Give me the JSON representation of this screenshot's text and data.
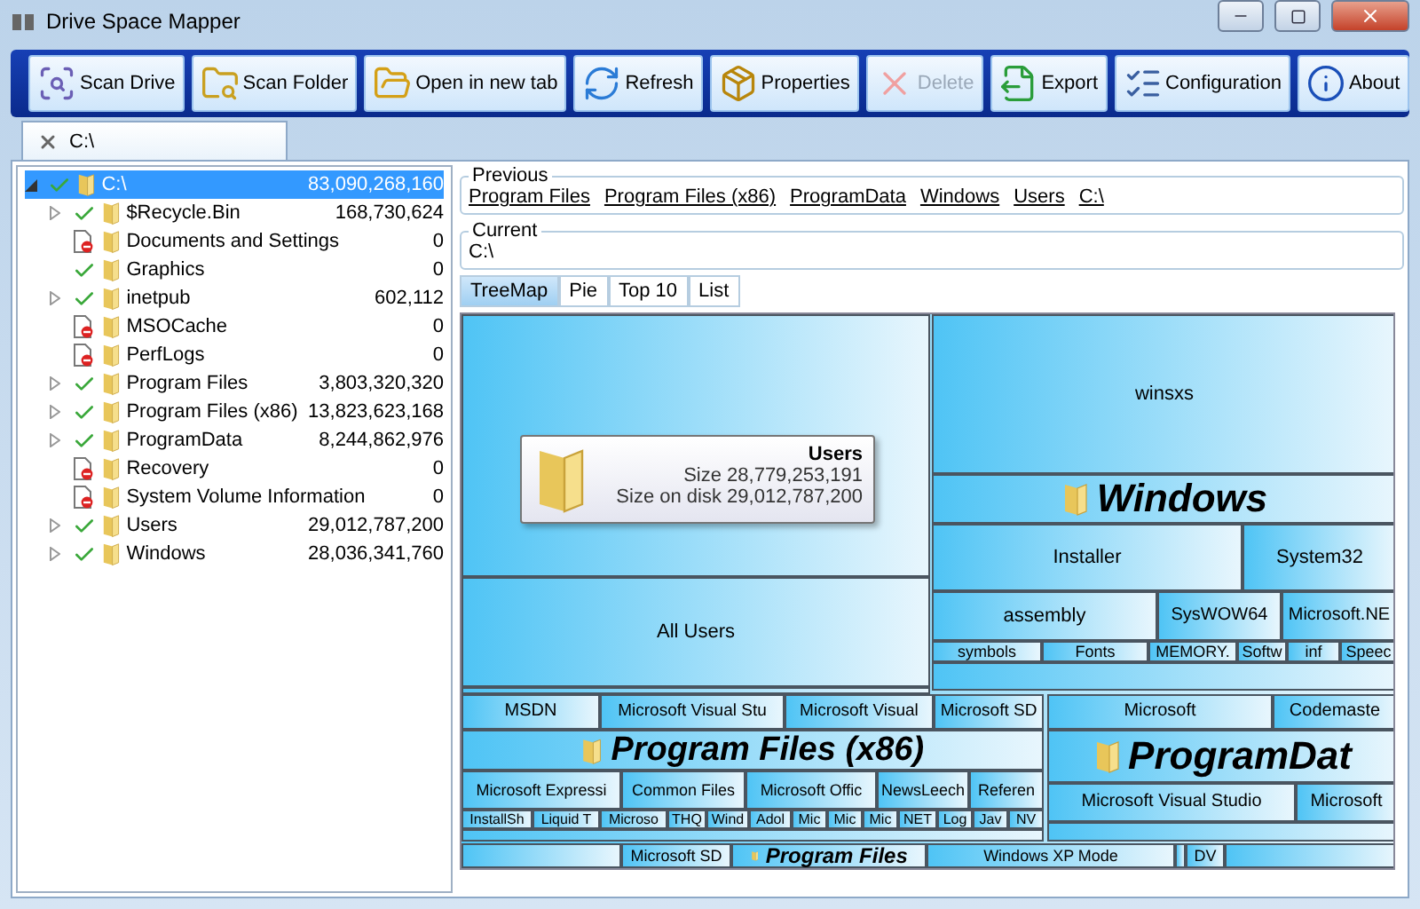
{
  "window": {
    "title": "Drive Space Mapper"
  },
  "toolbar": [
    {
      "label": "Scan Drive",
      "disabled": false
    },
    {
      "label": "Scan Folder",
      "disabled": false
    },
    {
      "label": "Open in new tab",
      "disabled": false
    },
    {
      "label": "Refresh",
      "disabled": false
    },
    {
      "label": "Properties",
      "disabled": false
    },
    {
      "label": "Delete",
      "disabled": true
    },
    {
      "label": "Export",
      "disabled": false
    },
    {
      "label": "Configuration",
      "disabled": false
    },
    {
      "label": "About",
      "disabled": false
    }
  ],
  "tabs": [
    {
      "label": "C:\\",
      "selected": true
    }
  ],
  "tree": {
    "name": "C:\\",
    "size": "83,090,268,160",
    "expanded": true,
    "selected": true,
    "accessible": true,
    "children": [
      {
        "name": "$Recycle.Bin",
        "size": "168,730,624",
        "accessible": true,
        "expandable": true
      },
      {
        "name": "Documents and Settings",
        "size": "0",
        "accessible": false,
        "expandable": false
      },
      {
        "name": "Graphics",
        "size": "0",
        "accessible": true,
        "expandable": false
      },
      {
        "name": "inetpub",
        "size": "602,112",
        "accessible": true,
        "expandable": true
      },
      {
        "name": "MSOCache",
        "size": "0",
        "accessible": false,
        "expandable": false
      },
      {
        "name": "PerfLogs",
        "size": "0",
        "accessible": false,
        "expandable": false
      },
      {
        "name": "Program Files",
        "size": "3,803,320,320",
        "accessible": true,
        "expandable": true
      },
      {
        "name": "Program Files (x86)",
        "size": "13,823,623,168",
        "accessible": true,
        "expandable": true
      },
      {
        "name": "ProgramData",
        "size": "8,244,862,976",
        "accessible": true,
        "expandable": true
      },
      {
        "name": "Recovery",
        "size": "0",
        "accessible": false,
        "expandable": false
      },
      {
        "name": "System Volume Information",
        "size": "0",
        "accessible": false,
        "expandable": false
      },
      {
        "name": "Users",
        "size": "29,012,787,200",
        "accessible": true,
        "expandable": true
      },
      {
        "name": "Windows",
        "size": "28,036,341,760",
        "accessible": true,
        "expandable": true
      }
    ]
  },
  "previous": {
    "title": "Previous",
    "links": [
      "Program Files",
      "Program Files (x86)",
      "ProgramData",
      "Windows",
      "Users",
      "C:\\"
    ]
  },
  "current": {
    "title": "Current",
    "path": "C:\\"
  },
  "view_tabs": [
    {
      "label": "TreeMap",
      "selected": true
    },
    {
      "label": "Pie",
      "selected": false
    },
    {
      "label": "Top 10",
      "selected": false
    },
    {
      "label": "List",
      "selected": false
    }
  ],
  "treemap": {
    "cells": [
      {
        "label": "All Users"
      },
      {
        "label": "winsxs"
      },
      {
        "label": "Installer"
      },
      {
        "label": "System32"
      },
      {
        "label": "assembly"
      },
      {
        "label": "SysWOW64"
      },
      {
        "label": "Microsoft.NE"
      },
      {
        "label": "symbols"
      },
      {
        "label": "Fonts"
      },
      {
        "label": "MEMORY."
      },
      {
        "label": "Softw"
      },
      {
        "label": "inf"
      },
      {
        "label": "Speec"
      },
      {
        "label": "MSDN"
      },
      {
        "label": "Microsoft Visual Stu"
      },
      {
        "label": "Microsoft Visual"
      },
      {
        "label": "Microsoft SD"
      },
      {
        "label": "Microsoft Expressi"
      },
      {
        "label": "Common Files"
      },
      {
        "label": "Microsoft Offic"
      },
      {
        "label": "NewsLeech"
      },
      {
        "label": "Referen"
      },
      {
        "label": "InstallSh"
      },
      {
        "label": "Liquid T"
      },
      {
        "label": "Microso"
      },
      {
        "label": "THQ"
      },
      {
        "label": "Wind"
      },
      {
        "label": "Adol"
      },
      {
        "label": "Mic"
      },
      {
        "label": "Mic"
      },
      {
        "label": "Mic"
      },
      {
        "label": "NET"
      },
      {
        "label": "Log"
      },
      {
        "label": "Jav"
      },
      {
        "label": "NV"
      },
      {
        "label": "Microsoft"
      },
      {
        "label": "Codemaste"
      },
      {
        "label": "Microsoft Visual Studio"
      },
      {
        "label": "Microsoft"
      },
      {
        "label": "Microsoft SD"
      },
      {
        "label": "Windows XP Mode"
      },
      {
        "label": "DV"
      }
    ],
    "groups": [
      {
        "label": "Windows"
      },
      {
        "label": "Program Files (x86)"
      },
      {
        "label": "ProgramDat"
      },
      {
        "label": "Program Files"
      }
    ],
    "tooltip": {
      "title": "Users",
      "lines": [
        "Size 28,779,253,191",
        "Size on disk 29,012,787,200"
      ]
    }
  }
}
